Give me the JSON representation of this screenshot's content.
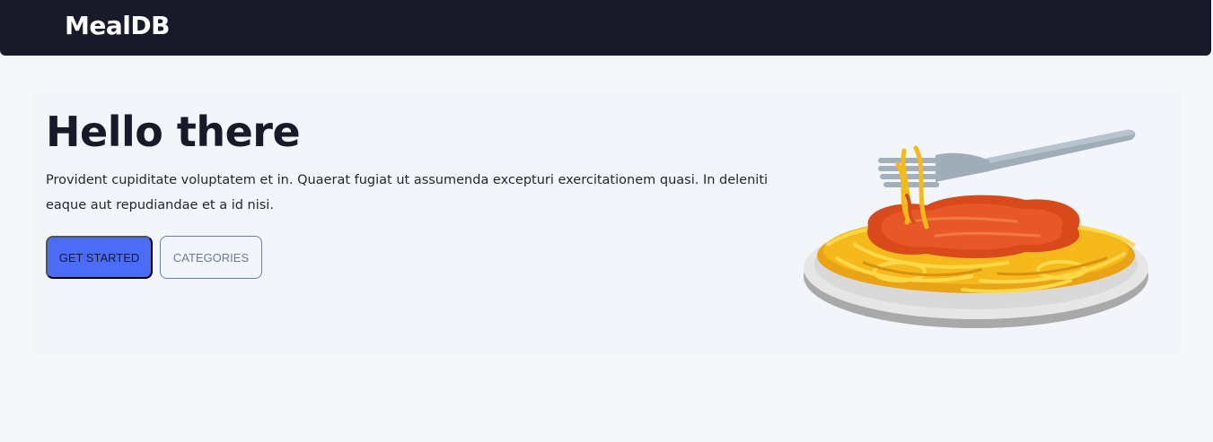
{
  "navbar": {
    "brand": "MealDB",
    "background": "#181a2a"
  },
  "hero": {
    "title": "Hello there",
    "description": "Provident cupiditate voluptatem et in. Quaerat fugiat ut assumenda excepturi exercitationem quasi. In deleniti eaque aut repudiandae et a id nisi.",
    "primary_button": "GET STARTED",
    "secondary_button": "CATEGORIES",
    "image_icon": "spaghetti-plate-icon",
    "colors": {
      "primary": "#4a6cf7",
      "title": "#181a2a"
    }
  }
}
